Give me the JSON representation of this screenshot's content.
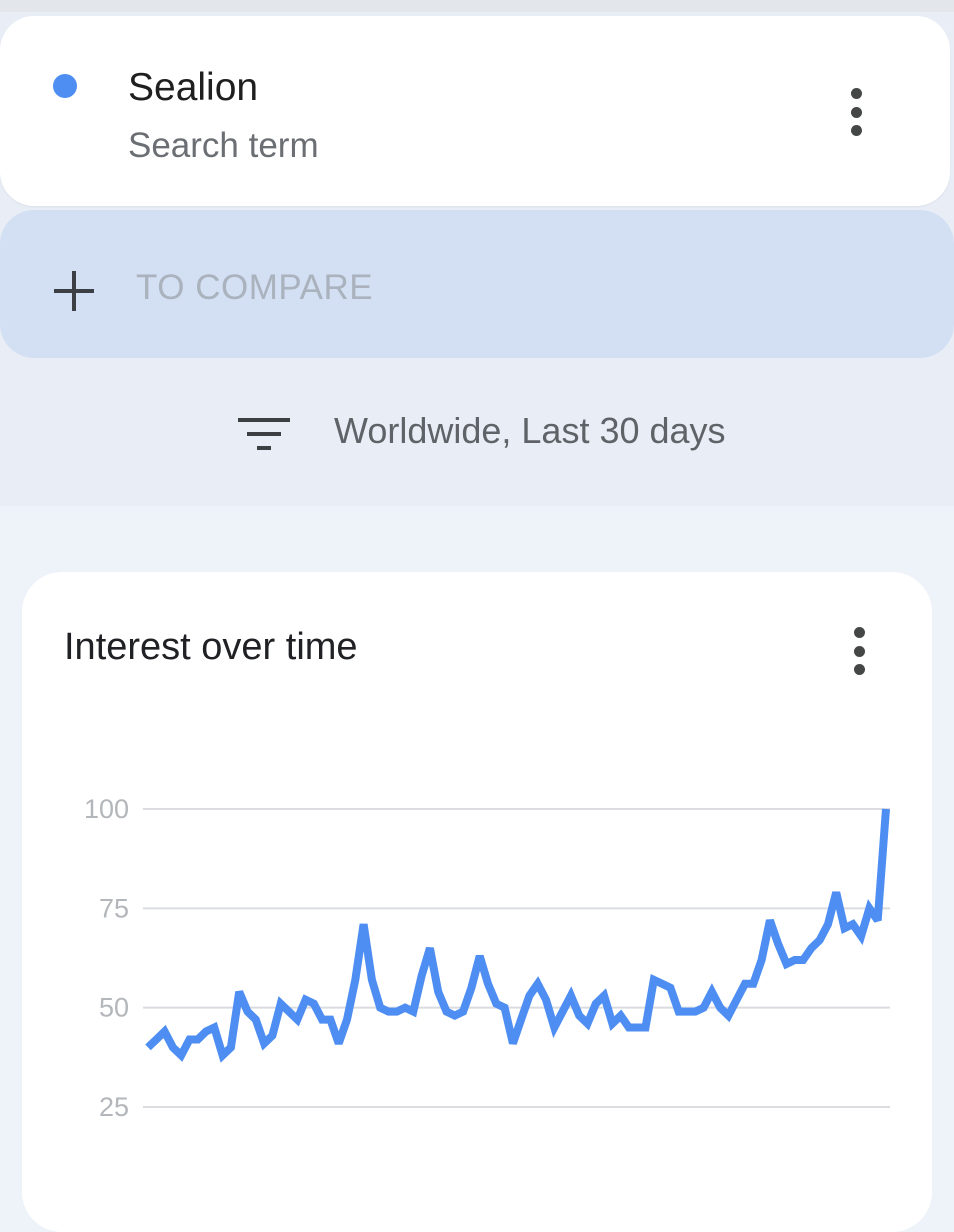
{
  "search_term": {
    "name": "Sealion",
    "subtitle": "Search term",
    "dot_color": "#4e8ef2"
  },
  "compare": {
    "label": "TO COMPARE"
  },
  "filter": {
    "label": "Worldwide, Last 30 days"
  },
  "chart_card": {
    "title": "Interest over time"
  },
  "chart_data": {
    "type": "line",
    "title": "Interest over time",
    "xlabel": "",
    "ylabel": "",
    "ylim": [
      25,
      100
    ],
    "yticks": [
      "100",
      "75",
      "50",
      "25"
    ],
    "grid": true,
    "line_color": "#4e8ef2",
    "series": [
      {
        "values": [
          40,
          42,
          44,
          40,
          38,
          42,
          42,
          44,
          45,
          38,
          40,
          54,
          49,
          47,
          41,
          43,
          51,
          49,
          47,
          52,
          51,
          47,
          47,
          41,
          47,
          57,
          71,
          57,
          50,
          49,
          49,
          50,
          49,
          58,
          65,
          54,
          49,
          48,
          49,
          55,
          63,
          56,
          51,
          50,
          41,
          47,
          53,
          56,
          52,
          45,
          49,
          53,
          48,
          46,
          51,
          53,
          46,
          48,
          45,
          45,
          45,
          57,
          56,
          55,
          49,
          49,
          49,
          50,
          54,
          50,
          48,
          52,
          56,
          56,
          62,
          72,
          66,
          61,
          62,
          62,
          65,
          67,
          71,
          79,
          70,
          71,
          68,
          75,
          72,
          100
        ]
      }
    ]
  }
}
